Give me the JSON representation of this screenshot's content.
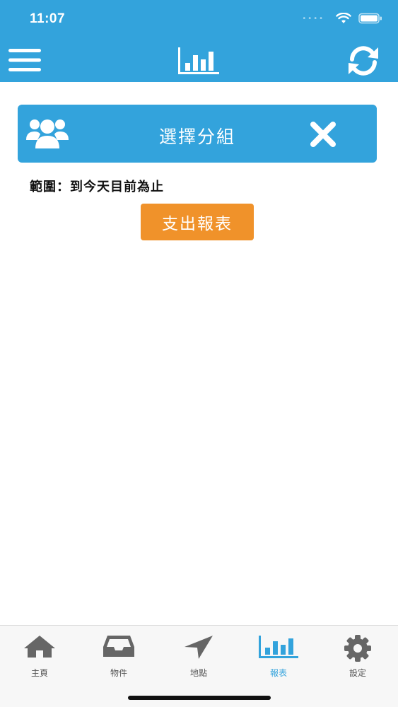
{
  "status_bar": {
    "time": "11:07"
  },
  "header": {
    "menu_icon": "hamburger-icon",
    "title_icon": "bar-chart-icon",
    "refresh_icon": "refresh-icon"
  },
  "group_selector": {
    "label": "選擇分組",
    "icon": "users-group-icon",
    "close_icon": "close-icon"
  },
  "range": {
    "text": "範圍：到今天目前為止"
  },
  "report_button": {
    "label": "支出報表",
    "color": "#f0922a"
  },
  "tabbar": {
    "tabs": [
      {
        "label": "主頁",
        "icon": "home-icon"
      },
      {
        "label": "物件",
        "icon": "inbox-icon"
      },
      {
        "label": "地點",
        "icon": "location-arrow-icon"
      },
      {
        "label": "報表",
        "icon": "bar-chart-icon",
        "active": true
      },
      {
        "label": "設定",
        "icon": "gear-icon"
      }
    ]
  },
  "colors": {
    "primary": "#33a3dc",
    "accent": "#f0922a",
    "tab_inactive": "#555555"
  }
}
